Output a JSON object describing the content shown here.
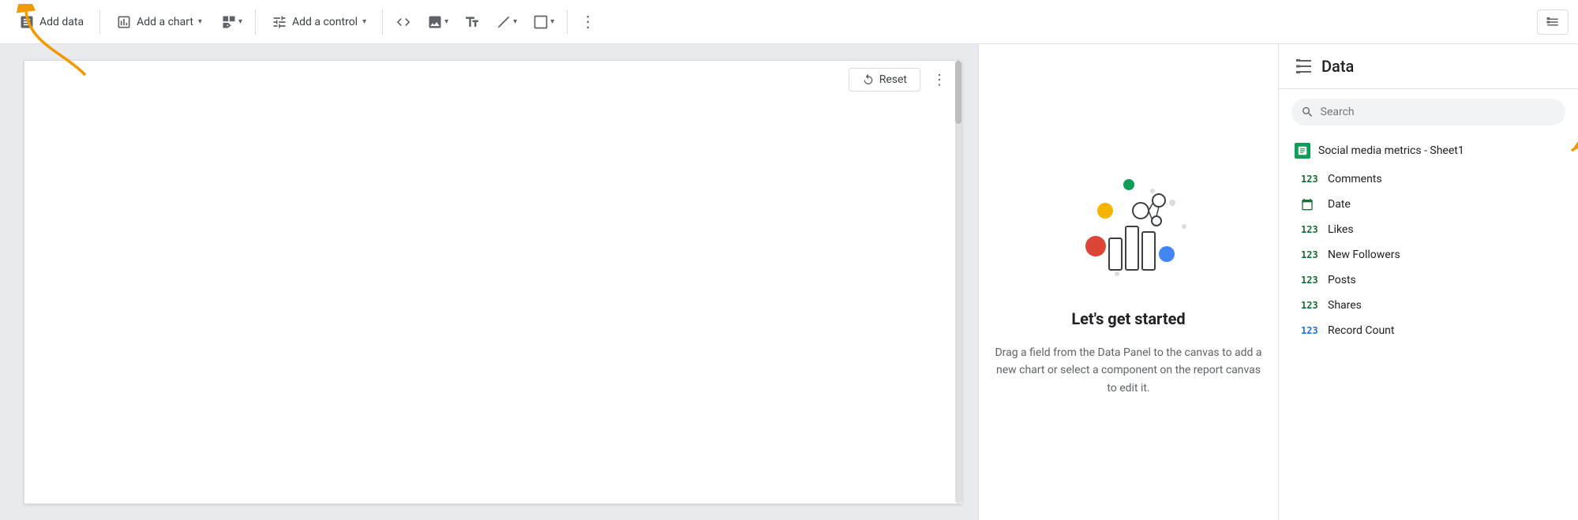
{
  "toolbar": {
    "add_data_label": "Add data",
    "add_chart_label": "Add a chart",
    "add_control_label": "Add a control",
    "more_options_tooltip": "More options",
    "view_toggle_tooltip": "Toggle view"
  },
  "canvas": {
    "reset_label": "Reset"
  },
  "center": {
    "illustration_alt": "Chart illustration",
    "heading": "Let's get started",
    "description": "Drag a field from the Data Panel to the canvas to add a new chart or select a component on the report canvas to edit it."
  },
  "data_panel": {
    "title": "Data",
    "search_placeholder": "Search",
    "data_source": {
      "name": "Social media metrics - Sheet1",
      "icon": "sheets"
    },
    "fields": [
      {
        "name": "Comments",
        "type": "123",
        "color": "green"
      },
      {
        "name": "Date",
        "type": "cal",
        "color": "green"
      },
      {
        "name": "Likes",
        "type": "123",
        "color": "green"
      },
      {
        "name": "New Followers",
        "type": "123",
        "color": "green"
      },
      {
        "name": "Posts",
        "type": "123",
        "color": "green"
      },
      {
        "name": "Shares",
        "type": "123",
        "color": "green"
      },
      {
        "name": "Record Count",
        "type": "123",
        "color": "blue"
      }
    ]
  }
}
